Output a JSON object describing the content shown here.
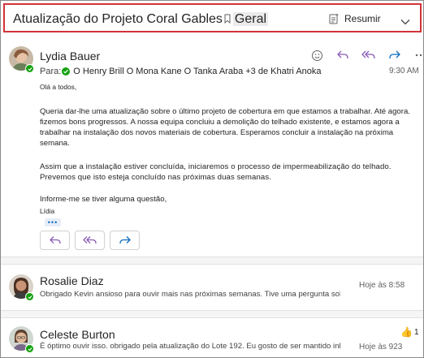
{
  "header": {
    "subject": "Atualização do Projeto Coral Gables",
    "tag": "Geral",
    "summarize_label": "Resumir"
  },
  "message": {
    "sender": "Lydia Bauer",
    "to_label": "Para:",
    "recipients": "O Henry Brill O Mona Kane O Tanka Araba +3 de Khatri Anoka",
    "time": "9:30 AM",
    "greeting": "Olá a todos,",
    "paragraph1": "Queria dar-lhe uma atualização sobre o último projeto de cobertura em que estamos a trabalhar. Até agora. fizemos bons progressos. A nossa equipa concluiu a demolição do telhado existente, e estamos agora a trabalhar na instalação dos novos materiais de cobertura. Esperamos concluir a instalação na próxima semana.",
    "paragraph2": "Assim que a instalação estiver concluída, iniciaremos o processo de impermeabilização do telhado. Prevemos que isto esteja concluído nas próximas duas semanas.",
    "closing": "Informe-me se tiver alguma questão,",
    "signature": "Lídia",
    "ellipsis": "•••"
  },
  "thread": [
    {
      "sender": "Rosalie Diaz",
      "preview": "Obrigado Kevin ansioso para ouvir mais nas próximas semanas. Tive uma pergunta sobre o custo final",
      "time": "Hoje às 8:58"
    },
    {
      "sender": "Celeste Burton",
      "preview": "É óptimo ouvir isso. obrigado pela atualização do Lote 192. Eu gosto de ser mantido inborne",
      "time": "Hoje às 923",
      "reaction": "👍",
      "reaction_count": "1"
    }
  ],
  "colors": {
    "accent_purple": "#8a5bb6",
    "accent_blue": "#0f6cbd",
    "highlight_red": "#d13438",
    "presence_green": "#13a10e"
  }
}
